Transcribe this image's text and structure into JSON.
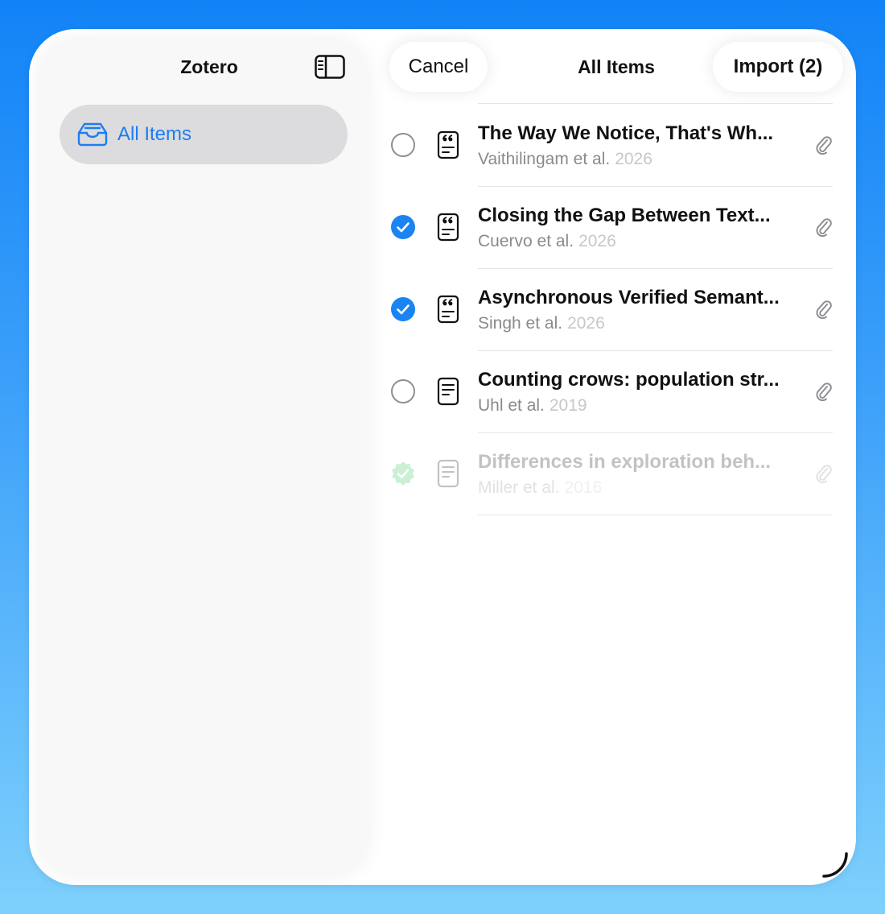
{
  "sidebar": {
    "title": "Zotero",
    "toggle_icon": "sidebar-toggle-icon",
    "items": [
      {
        "label": "All Items",
        "icon": "tray-icon",
        "selected": true
      }
    ]
  },
  "toolbar": {
    "cancel_label": "Cancel",
    "title": "All Items",
    "import_label": "Import (2)"
  },
  "items": [
    {
      "title": "The Way We Notice, That's Wh...",
      "authors": "Vaithilingam et al.",
      "year": "2026",
      "checked": false,
      "type_icon": "quote-document-icon",
      "has_attachment": true,
      "state": "normal"
    },
    {
      "title": "Closing the Gap Between Text...",
      "authors": "Cuervo et al.",
      "year": "2026",
      "checked": true,
      "type_icon": "quote-document-icon",
      "has_attachment": true,
      "state": "normal"
    },
    {
      "title": "Asynchronous Verified Semant...",
      "authors": "Singh et al.",
      "year": "2026",
      "checked": true,
      "type_icon": "quote-document-icon",
      "has_attachment": true,
      "state": "normal"
    },
    {
      "title": "Counting crows: population str...",
      "authors": "Uhl et al.",
      "year": "2019",
      "checked": false,
      "type_icon": "document-icon",
      "has_attachment": true,
      "state": "normal"
    },
    {
      "title": "Differences in exploration beh...",
      "authors": "Miller et al.",
      "year": "2016",
      "checked": true,
      "type_icon": "document-icon",
      "has_attachment": true,
      "state": "imported"
    }
  ],
  "colors": {
    "accent": "#1e7cf0",
    "check_blue": "#1a84f2",
    "imported_green": "#34c759",
    "selected_bg": "#dcdcde"
  }
}
